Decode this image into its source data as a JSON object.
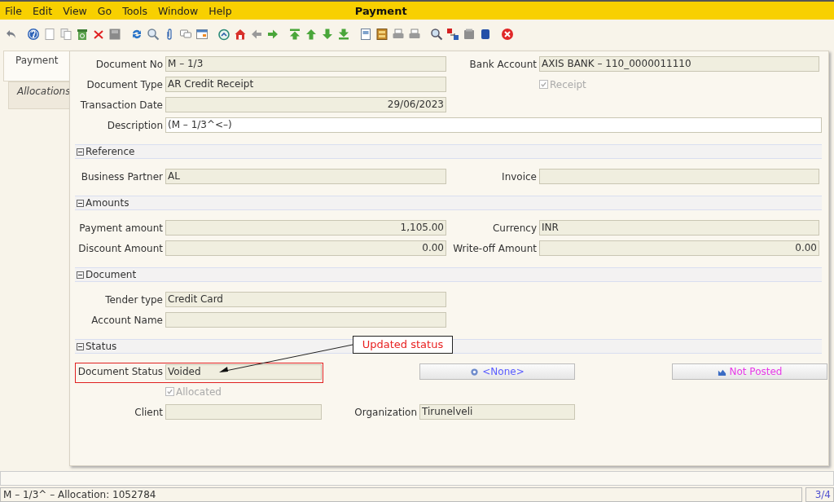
{
  "window": {
    "title": "Payment"
  },
  "menu": [
    "File",
    "Edit",
    "View",
    "Go",
    "Tools",
    "Window",
    "Help"
  ],
  "tabs": [
    {
      "label": "Payment",
      "selected": true
    },
    {
      "label": "Allocations",
      "selected": false
    }
  ],
  "sections": [
    {
      "kind": "pairs",
      "rows": [
        [
          {
            "kind": "field",
            "label": "Document No",
            "value": "M – 1/3",
            "readonly": true
          },
          {
            "kind": "field",
            "label": "Bank Account",
            "value": "AXIS BANK – 110_0000011110",
            "readonly": true
          }
        ],
        [
          {
            "kind": "field",
            "label": "Document Type",
            "value": "AR Credit Receipt",
            "readonly": true
          },
          {
            "kind": "checkbox",
            "label": "Receipt",
            "checked": true,
            "disabled": true
          }
        ],
        [
          {
            "kind": "date",
            "label": "Transaction Date",
            "value": "29/06/2023",
            "readonly": true
          }
        ],
        [
          {
            "kind": "field",
            "label": "Description",
            "value": "(M – 1/3^<–)",
            "readonly": false,
            "wide": true
          }
        ]
      ]
    },
    {
      "kind": "pairs",
      "title": "Reference",
      "expanded": true,
      "rows": [
        [
          {
            "kind": "field",
            "label": "Business Partner",
            "value": "AL",
            "readonly": true
          },
          {
            "kind": "field",
            "label": "Invoice",
            "readonly": true
          }
        ]
      ]
    },
    {
      "kind": "pairs",
      "title": "Amounts",
      "expanded": true,
      "rows": [
        [
          {
            "kind": "amount",
            "label": "Payment amount",
            "value": "1,105.00",
            "readonly": true
          },
          {
            "kind": "field",
            "label": "Currency",
            "value": "INR",
            "readonly": true
          }
        ],
        [
          {
            "kind": "amount",
            "label": "Discount Amount",
            "value": "0.00",
            "readonly": true
          },
          {
            "kind": "amount",
            "label": "Write-off Amount",
            "value": "0.00",
            "readonly": true
          }
        ]
      ]
    },
    {
      "kind": "pairs",
      "title": "Document",
      "expanded": true,
      "rows": [
        [
          {
            "kind": "field",
            "label": "Tender type",
            "value": "Credit Card",
            "readonly": true
          }
        ],
        [
          {
            "kind": "field",
            "label": "Account Name",
            "readonly": true
          }
        ]
      ]
    },
    {
      "kind": "triples",
      "title": "Status",
      "expanded": true,
      "rows": [
        [
          {
            "kind": "field",
            "label": "Document Status",
            "value": "Voided",
            "readonly": true,
            "highlight": true
          },
          {
            "kind": "button",
            "label": "<None>",
            "color": "#5a5cff"
          },
          {
            "kind": "button",
            "label": "Not Posted",
            "color": "#e83ce8"
          }
        ],
        [
          {
            "kind": "checkbox",
            "label": "Allocated",
            "checked": true,
            "disabled": true
          }
        ],
        [
          {
            "kind": "field",
            "label": "Client",
            "readonly": true
          },
          {
            "kind": "field",
            "label": "Organization",
            "value": "Tirunelveli",
            "readonly": true
          }
        ]
      ]
    }
  ],
  "annotation": {
    "callout": "Updated status"
  },
  "status_bar": {
    "message": "M – 1/3^ – Allocation: 1052784",
    "record": "3/4"
  }
}
